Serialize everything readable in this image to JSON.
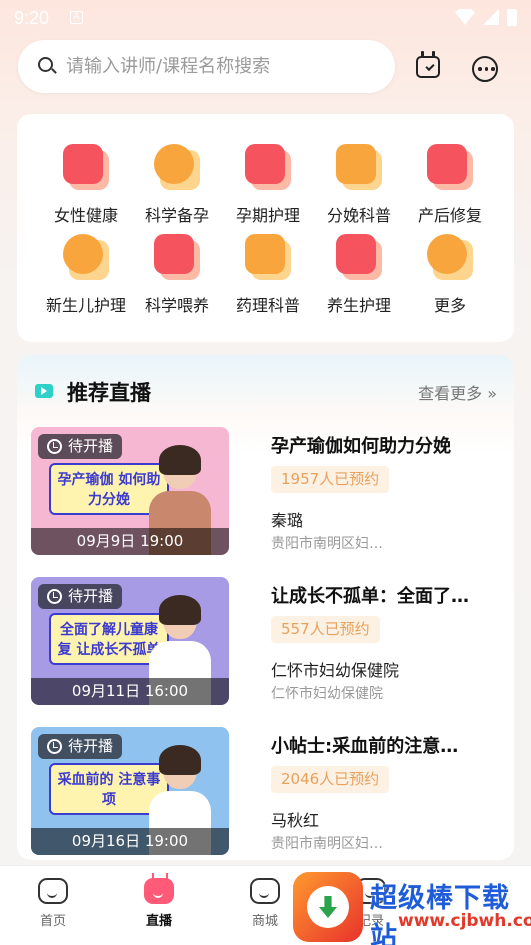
{
  "status_bar": {
    "time": "9:20",
    "notif": "A"
  },
  "search": {
    "placeholder": "请输入讲师/课程名称搜索"
  },
  "categories": [
    {
      "label": "女性健康",
      "icon": "female-icon",
      "color": "#f5545f"
    },
    {
      "label": "科学备孕",
      "icon": "sperm-icon",
      "color": "#f9a53d"
    },
    {
      "label": "孕期护理",
      "icon": "book-heart-icon",
      "color": "#f5545f"
    },
    {
      "label": "分娩科普",
      "icon": "clipboard-icon",
      "color": "#f9a53d"
    },
    {
      "label": "产后修复",
      "icon": "body-icon",
      "color": "#f5545f"
    },
    {
      "label": "新生儿护理",
      "icon": "baby-face-icon",
      "color": "#f9a53d"
    },
    {
      "label": "科学喂养",
      "icon": "baby-id-icon",
      "color": "#f5545f"
    },
    {
      "label": "药理科普",
      "icon": "pill-icon",
      "color": "#f9a53d"
    },
    {
      "label": "养生护理",
      "icon": "mortar-icon",
      "color": "#f5545f"
    },
    {
      "label": "更多",
      "icon": "more-dots-icon",
      "color": "#f9a53d"
    }
  ],
  "live": {
    "title": "推荐直播",
    "more": "查看更多",
    "items": [
      {
        "status": "待开播",
        "poster_text": "孕产瑜伽 如何助力分娩",
        "time": "09月9日 19:00",
        "title": "孕产瑜伽如何助力分娩",
        "booked": "1957人已预约",
        "speaker": "秦璐",
        "org": "贵阳市南明区妇…",
        "thumb_bg": "#f6b7d3",
        "coat": "#c9876d"
      },
      {
        "status": "待开播",
        "poster_text": "全面了解儿童康复 让成长不孤单",
        "time": "09月11日 16:00",
        "title": "让成长不孤单：全面了…",
        "booked": "557人已预约",
        "speaker": "仁怀市妇幼保健院",
        "org": "仁怀市妇幼保健院",
        "thumb_bg": "#a89be6",
        "coat": "#ffffff"
      },
      {
        "status": "待开播",
        "poster_text": "采血前的 注意事项",
        "time": "09月16日 19:00",
        "title": "小帖士:采血前的注意…",
        "booked": "2046人已预约",
        "speaker": "马秋红",
        "org": "贵阳市南明区妇…",
        "thumb_bg": "#8fc2ef",
        "coat": "#ffffff"
      }
    ]
  },
  "tabs": [
    {
      "label": "首页",
      "icon": "home-icon",
      "active": false
    },
    {
      "label": "直播",
      "icon": "tv-icon",
      "active": true
    },
    {
      "label": "商城",
      "icon": "bag-icon",
      "active": false
    },
    {
      "label": "记录",
      "icon": "record-icon",
      "active": false
    }
  ],
  "watermark": {
    "text": "超级棒下载站",
    "url": "www.cjbwh.com"
  }
}
